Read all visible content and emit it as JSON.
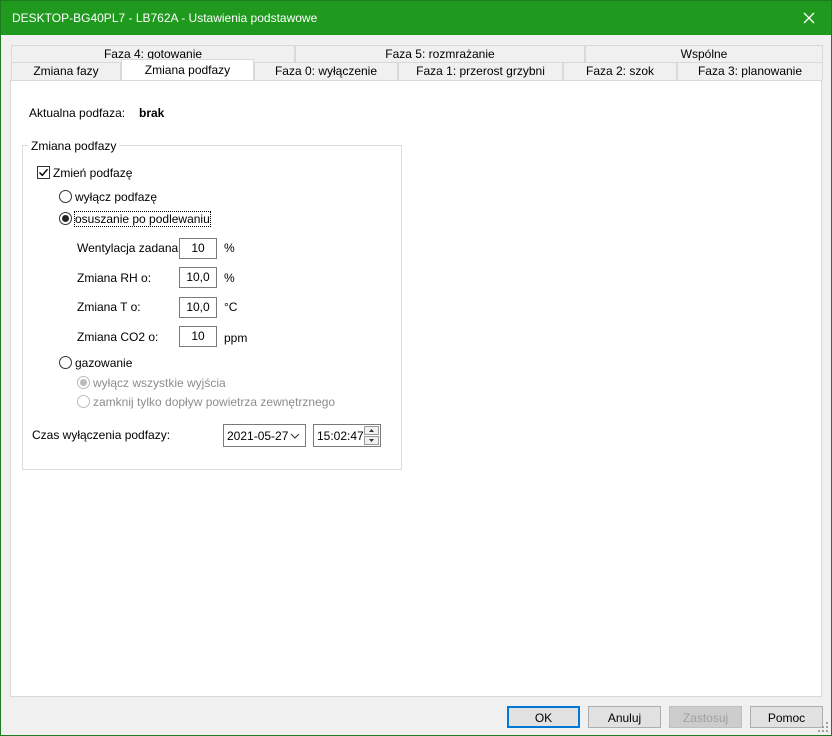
{
  "window": {
    "title": "DESKTOP-BG40PL7 - LB762A - Ustawienia podstawowe"
  },
  "tabs": {
    "row1": [
      {
        "label": "Faza 4: gotowanie"
      },
      {
        "label": "Faza 5: rozmrażanie"
      },
      {
        "label": "Wspólne"
      }
    ],
    "row2": [
      {
        "label": "Zmiana fazy"
      },
      {
        "label": "Zmiana podfazy",
        "active": true
      },
      {
        "label": "Faza 0: wyłączenie"
      },
      {
        "label": "Faza 1: przerost grzybni"
      },
      {
        "label": "Faza 2: szok"
      },
      {
        "label": "Faza 3: planowanie"
      }
    ]
  },
  "current": {
    "label": "Aktualna podfaza:",
    "value": "brak"
  },
  "group": {
    "title": "Zmiana podfazy",
    "change_checkbox": {
      "label": "Zmień podfazę",
      "checked": true
    },
    "radio_off": {
      "label": "wyłącz podfazę",
      "checked": false
    },
    "radio_dry": {
      "label": "osuszanie po podlewaniu",
      "checked": true
    },
    "params": [
      {
        "label": "Wentylacja zadana:",
        "value": "10",
        "unit": "%"
      },
      {
        "label": "Zmiana RH o:",
        "value": "10,0",
        "unit": "%"
      },
      {
        "label": "Zmiana T o:",
        "value": "10,0",
        "unit": "°C"
      },
      {
        "label": "Zmiana CO2 o:",
        "value": "10",
        "unit": "ppm"
      }
    ],
    "radio_gas": {
      "label": "gazowanie",
      "checked": false
    },
    "gas_options": [
      {
        "label": "wyłącz wszystkie wyjścia",
        "checked": true
      },
      {
        "label": "zamknij tylko dopływ powietrza zewnętrznego",
        "checked": false
      }
    ],
    "end_time": {
      "label": "Czas wyłączenia podfazy:",
      "date": "2021-05-27",
      "time": "15:02:47"
    }
  },
  "buttons": {
    "ok": "OK",
    "cancel": "Anuluj",
    "apply": "Zastosuj",
    "help": "Pomoc"
  },
  "colors": {
    "titlebar": "#1f9a1f",
    "focus_border": "#0078d7"
  }
}
